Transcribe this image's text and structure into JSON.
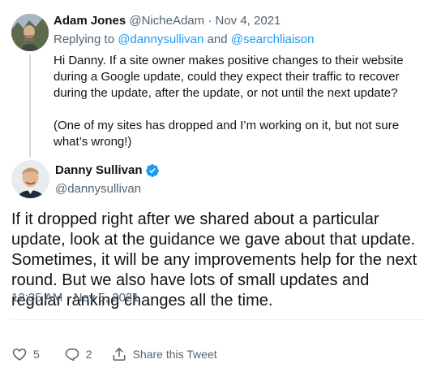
{
  "reply_tweet": {
    "author_name": "Adam Jones",
    "author_handle": "@NicheAdam",
    "separator": "·",
    "date": "Nov 4, 2021",
    "replying_to_prefix": "Replying to",
    "replying_to_user1": "@dannysullivan",
    "replying_to_and": "and",
    "replying_to_user2": "@searchliaison",
    "paragraphs": [
      "Hi Danny. If a site owner makes positive changes to their website during a Google update, could they expect their traffic to recover during the update, after the update, or not until the next update?",
      "(One of my sites has dropped and I’m working on it, but not sure what’s wrong!)"
    ]
  },
  "main_tweet": {
    "author_name": "Danny Sullivan",
    "author_handle": "@dannysullivan",
    "verified": true,
    "text": "If it dropped right after we shared about a particular update, look at the guidance we gave about that update. Sometimes, it will be any improvements help for the next round. But we also have lots of small updates and regular ranking changes all the time.",
    "timestamp": "12:35 AM · Nov 5, 2021"
  },
  "actions": {
    "like_count": "5",
    "reply_count": "2",
    "share_label": "Share this Tweet"
  },
  "colors": {
    "text": "#0f1419",
    "muted": "#536471",
    "link": "#1d9bf0",
    "verified": "#1d9bf0",
    "divider": "#eff3f4"
  },
  "icons": [
    "heart-icon",
    "reply-bubble-icon",
    "share-icon",
    "verified-badge-icon"
  ]
}
